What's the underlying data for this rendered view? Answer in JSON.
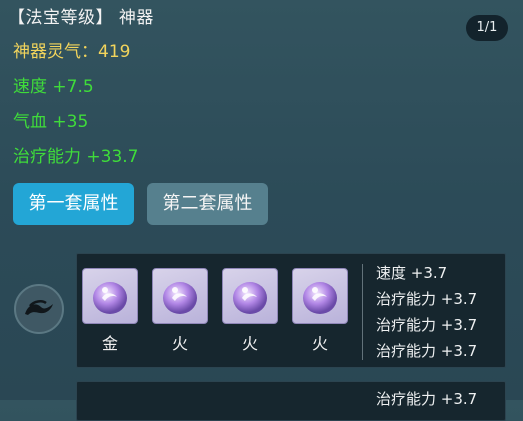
{
  "header": {
    "title": "【法宝等级】 神器",
    "pager": "1/1"
  },
  "stats": [
    {
      "text": "神器灵气：419",
      "color": "#f2d45c"
    },
    {
      "text": "速度 +7.5",
      "color": "#3fdc3a"
    },
    {
      "text": "气血 +35",
      "color": "#3fdc3a"
    },
    {
      "text": "治疗能力 +33.7",
      "color": "#3fdc3a"
    }
  ],
  "tabs": {
    "first": "第一套属性",
    "second": "第二套属性",
    "active_color": "#23a6d6"
  },
  "group1": {
    "icon": "dragon-emblem-icon",
    "slots": [
      {
        "icon": "purple-orb-icon",
        "element": "金"
      },
      {
        "icon": "purple-orb-icon",
        "element": "火"
      },
      {
        "icon": "purple-orb-icon",
        "element": "火"
      },
      {
        "icon": "purple-orb-icon",
        "element": "火"
      }
    ],
    "attributes": [
      "速度 +3.7",
      "治疗能力 +3.7",
      "治疗能力 +3.7",
      "治疗能力 +3.7"
    ]
  },
  "group2": {
    "attributes": [
      "治疗能力 +3.7"
    ]
  }
}
